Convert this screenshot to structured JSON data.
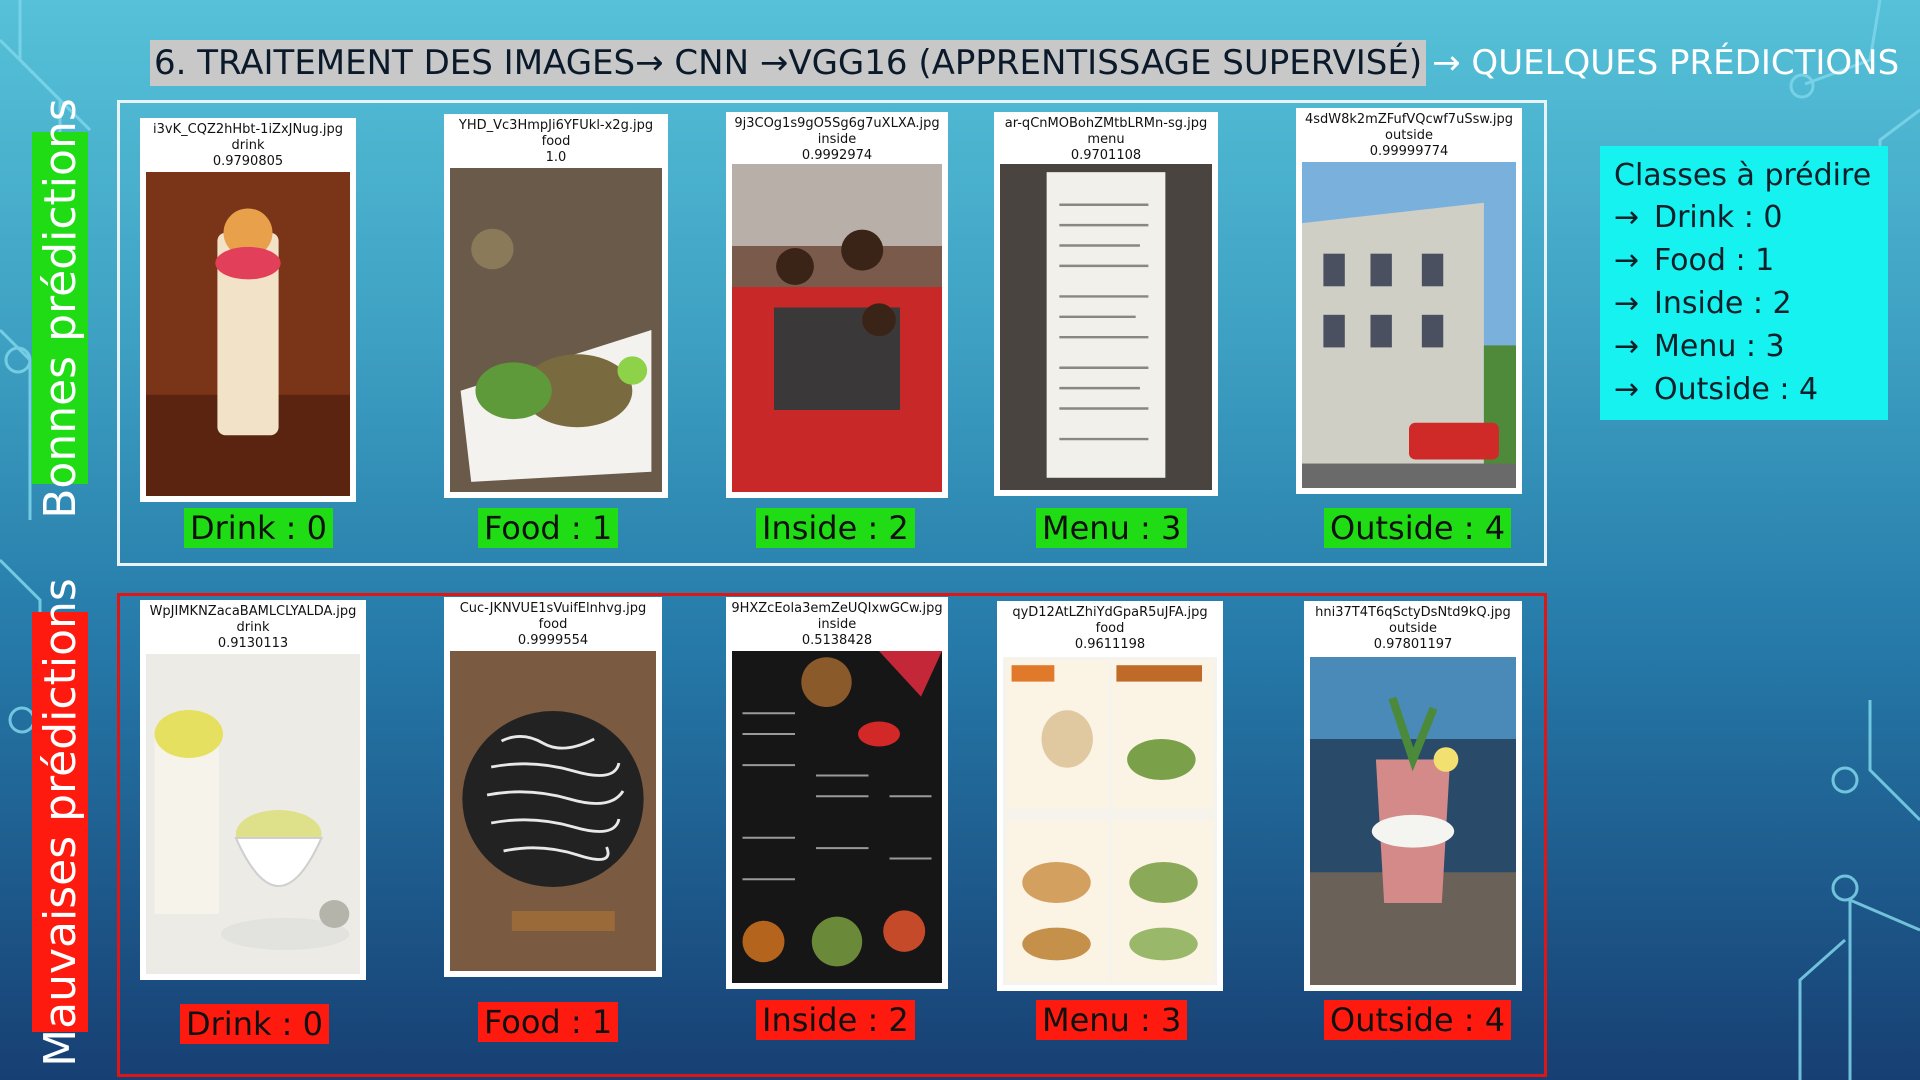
{
  "title": {
    "highlighted": "6. TRAITEMENT DES IMAGES→ CNN →VGG16 (APPRENTISSAGE SUPERVISÉ)",
    "rest": "→ QUELQUES PRÉDICTIONS"
  },
  "side_labels": {
    "good": "Bonnes prédictions",
    "bad": "Mauvaises prédictions"
  },
  "good_predictions": [
    {
      "file": "i3vK_CQZ2hHbt-1iZxJNug.jpg",
      "label": "drink",
      "score": "0.9790805",
      "caption": "Drink : 0",
      "photo": "drink-glass"
    },
    {
      "file": "YHD_Vc3HmpJi6YFUkl-x2g.jpg",
      "label": "food",
      "score": "1.0",
      "caption": "Food : 1",
      "photo": "food-plate"
    },
    {
      "file": "9j3COg1s9gO5Sg6g7uXLXA.jpg",
      "label": "inside",
      "score": "0.9992974",
      "caption": "Inside : 2",
      "photo": "restaurant-booth"
    },
    {
      "file": "ar-qCnMOBohZMtbLRMn-sg.jpg",
      "label": "menu",
      "score": "0.9701108",
      "caption": "Menu : 3",
      "photo": "menu-sheet"
    },
    {
      "file": "4sdW8k2mZFufVQcwf7uSsw.jpg",
      "label": "outside",
      "score": "0.99999774",
      "caption": "Outside : 4",
      "photo": "building-street"
    }
  ],
  "bad_predictions": [
    {
      "file": "WpJIMKNZacaBAMLCLYALDA.jpg",
      "label": "drink",
      "score": "0.9130113",
      "caption": "Drink : 0",
      "photo": "ice-cream-cups"
    },
    {
      "file": "Cuc-JKNVUE1sVuifElnhvg.jpg",
      "label": "food",
      "score": "0.9999554",
      "caption": "Food : 1",
      "photo": "chalkboard"
    },
    {
      "file": "9HXZcEola3emZeUQIxwGCw.jpg",
      "label": "inside",
      "score": "0.5138428",
      "caption": "Inside : 2",
      "photo": "dark-menu"
    },
    {
      "file": "qyD12AtLZhiYdGpaR5uJFA.jpg",
      "label": "food",
      "score": "0.9611198",
      "caption": "Menu : 3",
      "photo": "bakery-menu"
    },
    {
      "file": "hni37T4T6qSctyDsNtd9kQ.jpg",
      "label": "outside",
      "score": "0.97801197",
      "caption": "Outside : 4",
      "photo": "cocktail-bar"
    }
  ],
  "legend": {
    "title": "Classes à prédire",
    "arrow": "→",
    "items": [
      "Drink : 0",
      "Food : 1",
      "Inside : 2",
      "Menu : 3",
      "Outside : 4"
    ]
  },
  "colors": {
    "good": "#1fdc14",
    "bad": "#ff1a10",
    "legend_bg": "#16f2ef",
    "title_highlight": "#c8c8c8"
  }
}
